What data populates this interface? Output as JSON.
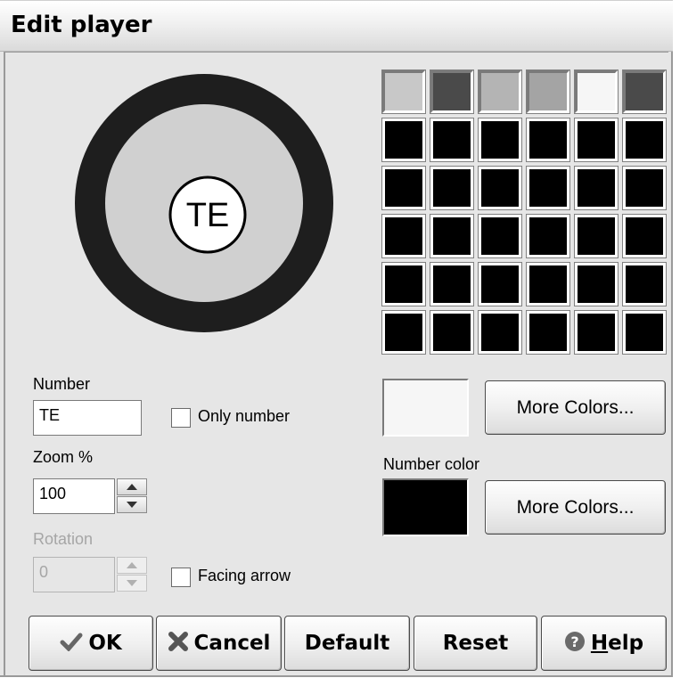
{
  "window": {
    "title": "Edit player"
  },
  "preview": {
    "label": "TE",
    "outer_color": "#1e1e1e",
    "inner_color": "#d0d0d0",
    "badge_color": "#ffffff"
  },
  "palette": {
    "rows": [
      [
        "#c8c8c8",
        "#4a4a4a",
        "#b4b4b4",
        "#a4a4a4",
        "#f6f6f6",
        "#4a4a4a"
      ],
      [
        "#000000",
        "#000000",
        "#000000",
        "#000000",
        "#000000",
        "#000000"
      ],
      [
        "#000000",
        "#000000",
        "#000000",
        "#000000",
        "#000000",
        "#000000"
      ],
      [
        "#000000",
        "#000000",
        "#000000",
        "#000000",
        "#000000",
        "#000000"
      ],
      [
        "#000000",
        "#000000",
        "#000000",
        "#000000",
        "#000000",
        "#000000"
      ],
      [
        "#000000",
        "#000000",
        "#000000",
        "#000000",
        "#000000",
        "#000000"
      ]
    ],
    "selected_color": "#f6f6f6",
    "more_colors_label": "More Colors..."
  },
  "number": {
    "label": "Number",
    "value": "TE",
    "only_number_label": "Only number",
    "only_number_checked": false
  },
  "zoom": {
    "label": "Zoom %",
    "value": "100"
  },
  "rotation": {
    "label": "Rotation",
    "value": "0",
    "enabled": false,
    "facing_arrow_label": "Facing arrow",
    "facing_arrow_checked": false
  },
  "number_color": {
    "label": "Number color",
    "color": "#000000",
    "more_colors_label": "More Colors..."
  },
  "buttons": {
    "ok": "OK",
    "cancel": "Cancel",
    "default": "Default",
    "reset": "Reset",
    "help_prefix": "",
    "help_mnemonic": "H",
    "help_rest": "elp"
  }
}
